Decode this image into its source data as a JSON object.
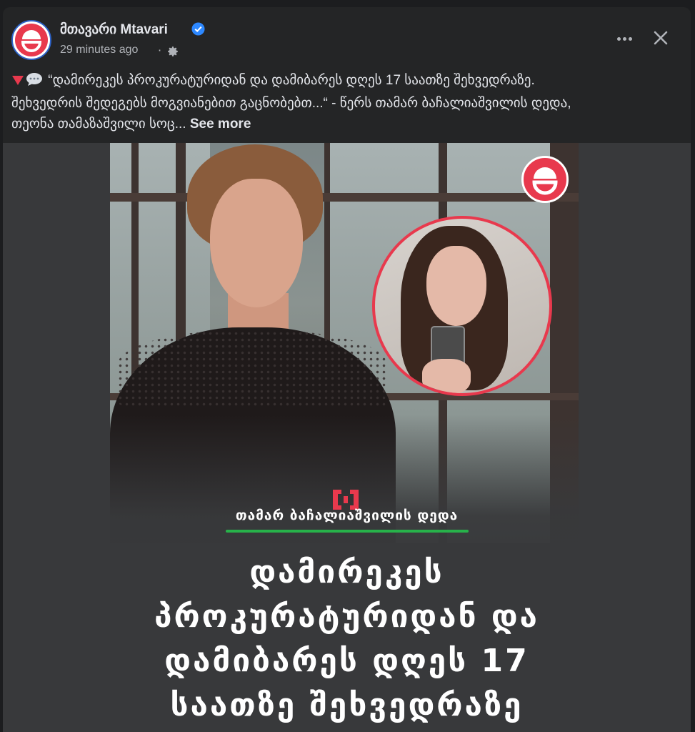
{
  "post": {
    "page_name": "მთავარი Mtavari",
    "timestamp": "29 minutes ago",
    "separator": "·",
    "caption_lines": [
      "“დამირეკეს პროკურატურიდან და დამიბარეს დღეს 17 საათზე შეხვედრაზე.",
      "შეხვედრის შედეგებს მოგვიანებით გაცნობებთ...“ - წერს თამარ ბაჩალიაშვილის დედა,",
      "თეონა თამაზაშვილი სოც..."
    ],
    "see_more": "See more",
    "icons": [
      "verified-badge-icon",
      "gear-icon",
      "more-options-icon",
      "close-icon",
      "red-triangle-icon",
      "speech-bubble-icon"
    ]
  },
  "media": {
    "speaker_label": "თამარ ბაჩალიაშვილის დედა",
    "headline_lines": [
      "დამირეკეს",
      "პროკურატურიდან და",
      "დამიბარეს დღეს 17",
      "საათზე შეხვედრაზე"
    ]
  },
  "colors": {
    "brand_red": "#e8394d",
    "verified_blue": "#2d88ff",
    "accent_green": "#27b24a",
    "card_bg": "#242526"
  }
}
